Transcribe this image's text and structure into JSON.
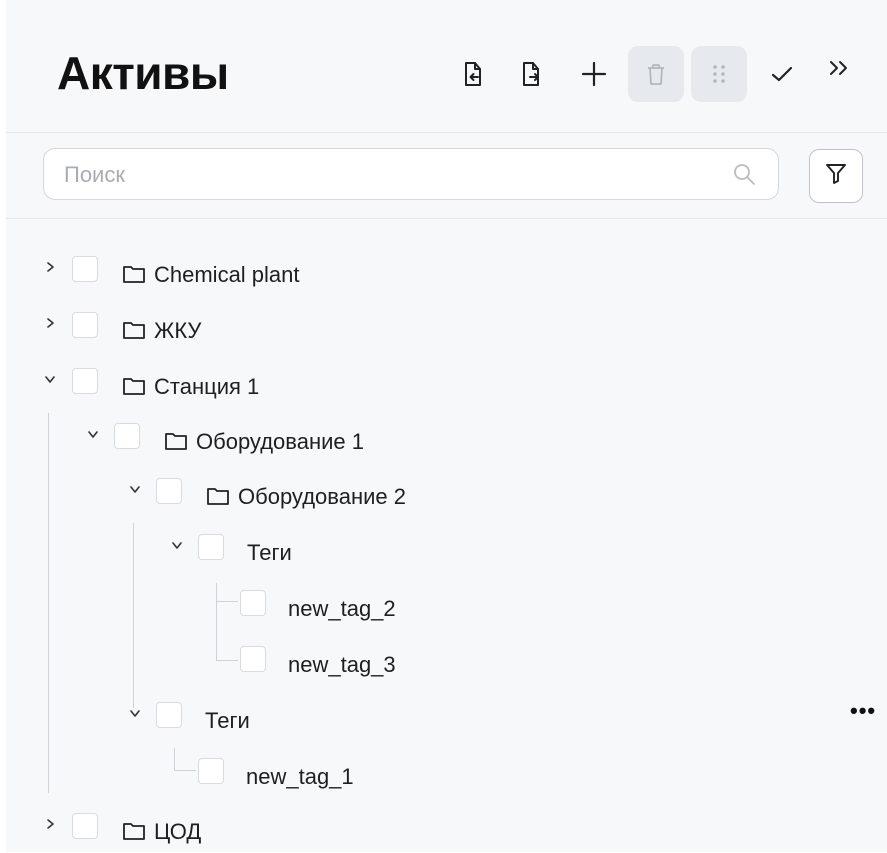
{
  "header": {
    "title": "Активы",
    "toolbar": [
      "import-icon",
      "export-icon",
      "plus-icon",
      "trash-icon",
      "drag-icon",
      "check-icon",
      "collapse-panel-icon"
    ]
  },
  "search": {
    "placeholder": "Поиск",
    "value": ""
  },
  "tree": {
    "nodes": [
      {
        "label": "Chemical plant",
        "level": 0,
        "expanded": false,
        "folder": true
      },
      {
        "label": "ЖКУ",
        "level": 0,
        "expanded": false,
        "folder": true
      },
      {
        "label": "Станция 1",
        "level": 0,
        "expanded": true,
        "folder": true
      },
      {
        "label": "Оборудование 1",
        "level": 1,
        "expanded": true,
        "folder": true
      },
      {
        "label": "Оборудование 2",
        "level": 2,
        "expanded": true,
        "folder": true
      },
      {
        "label": "Теги",
        "level": 3,
        "expanded": true,
        "folder": false
      },
      {
        "label": "new_tag_2",
        "level": 4,
        "leaf": true
      },
      {
        "label": "new_tag_3",
        "level": 4,
        "leaf": true
      },
      {
        "label": "Теги",
        "level": 2,
        "expanded": true,
        "folder": false
      },
      {
        "label": "new_tag_1",
        "level": 3,
        "leaf": true
      },
      {
        "label": "ЦОД",
        "level": 0,
        "expanded": false,
        "folder": true
      }
    ],
    "more_label": "•••"
  },
  "colors": {
    "panel_bg": "#f7f8fa",
    "disabled_btn_bg": "#e6e9ee",
    "tree_line": "#cfd3d8"
  }
}
